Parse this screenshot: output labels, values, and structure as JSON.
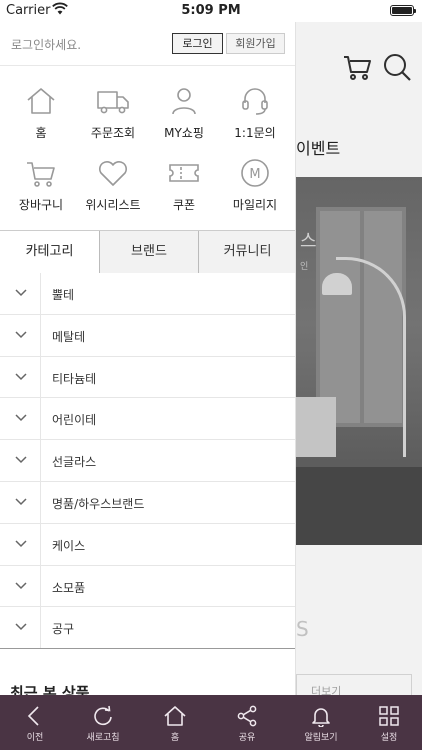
{
  "status_bar": {
    "carrier": "Carrier",
    "time": "5:09 PM"
  },
  "background": {
    "event_title": "이벤트",
    "hero_text": "스",
    "hero_sub": "인",
    "section_letter": "S",
    "more_button": "더보기"
  },
  "drawer": {
    "login_prompt": "로그인하세요.",
    "login_button": "로그인",
    "join_button": "회원가입",
    "menu": [
      {
        "label": "홈",
        "icon": "home-icon"
      },
      {
        "label": "주문조회",
        "icon": "truck-icon"
      },
      {
        "label": "MY쇼핑",
        "icon": "user-icon"
      },
      {
        "label": "1:1문의",
        "icon": "headset-icon"
      },
      {
        "label": "장바구니",
        "icon": "cart-icon"
      },
      {
        "label": "위시리스트",
        "icon": "heart-icon"
      },
      {
        "label": "쿠폰",
        "icon": "coupon-icon"
      },
      {
        "label": "마일리지",
        "icon": "mileage-icon"
      }
    ],
    "mileage_letter": "M",
    "tabs": [
      "카테고리",
      "브랜드",
      "커뮤니티"
    ],
    "categories": [
      "뿔테",
      "메탈테",
      "티타늄테",
      "어린이테",
      "선글라스",
      "명품/하우스브랜드",
      "케이스",
      "소모품",
      "공구"
    ],
    "recent_title": "최근 본 상품"
  },
  "toolbar": [
    {
      "label": "이전",
      "icon": "back-icon"
    },
    {
      "label": "새로고침",
      "icon": "refresh-icon"
    },
    {
      "label": "홈",
      "icon": "home-icon"
    },
    {
      "label": "공유",
      "icon": "share-icon"
    },
    {
      "label": "알림보기",
      "icon": "bell-icon"
    },
    {
      "label": "설정",
      "icon": "grid-icon"
    }
  ],
  "colors": {
    "toolbar_bg": "#4a3444",
    "icon_gray": "#999999"
  }
}
